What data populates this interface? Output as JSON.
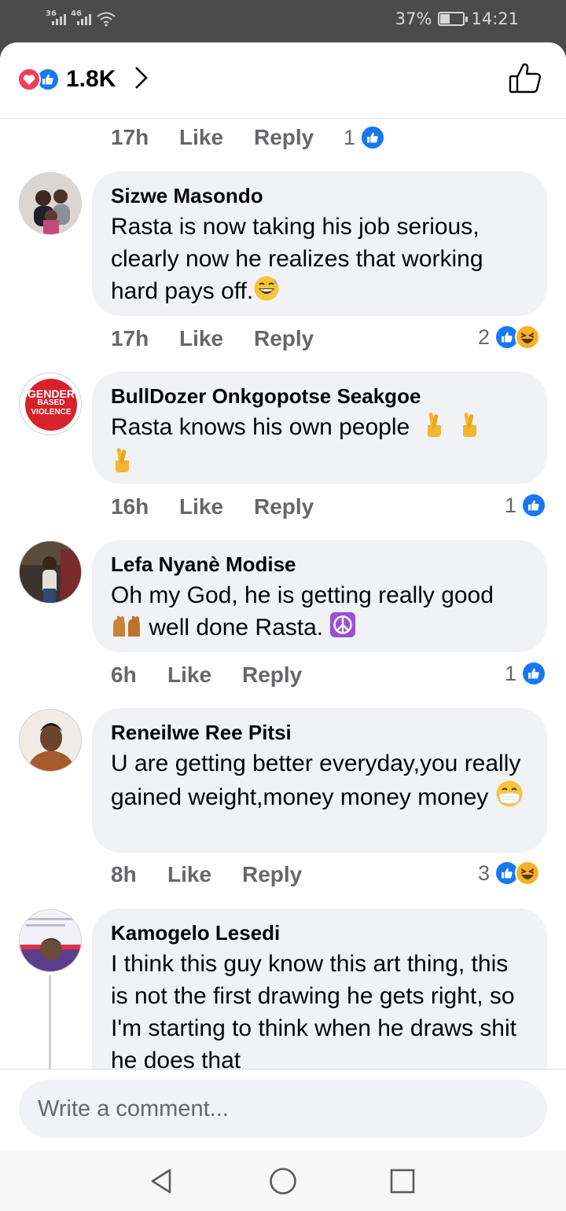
{
  "status_bar": {
    "network_1": "36",
    "network_2": "46",
    "battery": "37%",
    "battery_level": 0.37,
    "time": "14:21"
  },
  "header": {
    "reaction_count": "1.8K",
    "icons": [
      "love-icon",
      "like-icon",
      "chevron-right-icon",
      "thumbs-up-outline-icon"
    ]
  },
  "top_meta": {
    "time": "17h",
    "like": "Like",
    "reply": "Reply",
    "reactions": "1"
  },
  "comments": [
    {
      "author": "Sizwe Masondo",
      "text": "Rasta is now taking his job serious, clearly now he realizes that working hard pays off.",
      "emoji": "grinning-sweat-emoji",
      "time": "17h",
      "like": "Like",
      "reply": "Reply",
      "reactions": "2",
      "reaction_icons": [
        "like",
        "haha"
      ]
    },
    {
      "author": "BullDozer Onkgopotse Seakgoe",
      "text": "Rasta knows his own people",
      "emoji": "crossed-fingers-emoji",
      "avatar_text": [
        "GENDER",
        "BASED",
        "VIOLENCE"
      ],
      "time": "16h",
      "like": "Like",
      "reply": "Reply",
      "reactions": "1",
      "reaction_icons": [
        "like"
      ]
    },
    {
      "author": "Lefa Nyanè Modise",
      "text_1": "Oh my God, he is getting really good",
      "text_2": "well done Rasta.",
      "emoji": "raising-hands-emoji",
      "emoji_2": "peace-symbol-emoji",
      "time": "6h",
      "like": "Like",
      "reply": "Reply",
      "reactions": "1",
      "reaction_icons": [
        "like"
      ]
    },
    {
      "author": "Reneilwe Ree Pitsi",
      "text": "U are getting better everyday,you really gained weight,money money money",
      "emoji": "face-with-mask-emoji",
      "time": "8h",
      "like": "Like",
      "reply": "Reply",
      "reactions": "3",
      "reaction_icons": [
        "like",
        "haha"
      ]
    },
    {
      "author": "Kamogelo Lesedi",
      "text": "I think this guy know this art thing, this is not the first drawing he gets right, so I'm starting to think when he draws shit he does that"
    }
  ],
  "composer": {
    "placeholder": "Write a comment..."
  },
  "nav": {
    "icons": [
      "back-triangle-icon",
      "home-circle-icon",
      "recents-square-icon"
    ]
  },
  "colors": {
    "like_blue": "#1877f2",
    "love_red": "#f33e58",
    "haha_yellow": "#f7b125",
    "bubble_gray": "#f0f2f5",
    "meta_gray": "#65676b"
  }
}
